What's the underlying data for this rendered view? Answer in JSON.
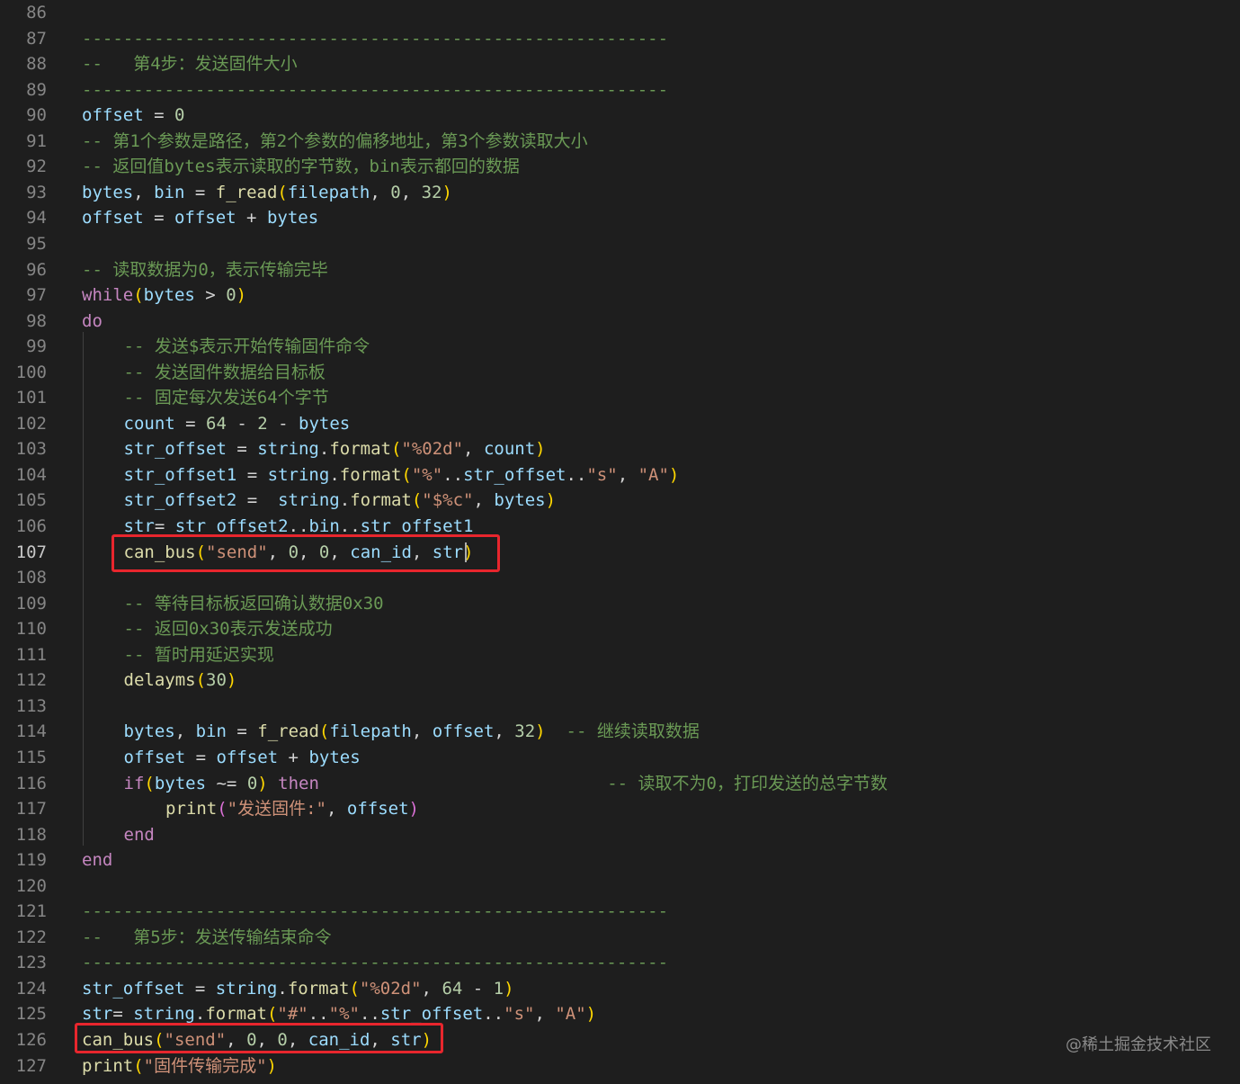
{
  "editor": {
    "lines": [
      {
        "n": "86",
        "indent": 0,
        "tokens": []
      },
      {
        "n": "87",
        "indent": 0,
        "tokens": [
          {
            "t": "c",
            "v": "---------------------------------------------------------"
          }
        ]
      },
      {
        "n": "88",
        "indent": 0,
        "tokens": [
          {
            "t": "c",
            "v": "--   第4步：发送固件大小"
          }
        ]
      },
      {
        "n": "89",
        "indent": 0,
        "tokens": [
          {
            "t": "c",
            "v": "---------------------------------------------------------"
          }
        ]
      },
      {
        "n": "90",
        "indent": 0,
        "tokens": [
          {
            "t": "v",
            "v": "offset"
          },
          {
            "t": "o",
            "v": " = "
          },
          {
            "t": "n",
            "v": "0"
          }
        ]
      },
      {
        "n": "91",
        "indent": 0,
        "tokens": [
          {
            "t": "c",
            "v": "-- 第1个参数是路径，第2个参数的偏移地址，第3个参数读取大小"
          }
        ]
      },
      {
        "n": "92",
        "indent": 0,
        "tokens": [
          {
            "t": "c",
            "v": "-- 返回值bytes表示读取的字节数，bin表示都回的数据"
          }
        ]
      },
      {
        "n": "93",
        "indent": 0,
        "tokens": [
          {
            "t": "v",
            "v": "bytes"
          },
          {
            "t": "o",
            "v": ", "
          },
          {
            "t": "v",
            "v": "bin"
          },
          {
            "t": "o",
            "v": " = "
          },
          {
            "t": "f",
            "v": "f_read"
          },
          {
            "t": "p1",
            "v": "("
          },
          {
            "t": "v",
            "v": "filepath"
          },
          {
            "t": "o",
            "v": ", "
          },
          {
            "t": "n",
            "v": "0"
          },
          {
            "t": "o",
            "v": ", "
          },
          {
            "t": "n",
            "v": "32"
          },
          {
            "t": "p1",
            "v": ")"
          }
        ]
      },
      {
        "n": "94",
        "indent": 0,
        "tokens": [
          {
            "t": "v",
            "v": "offset"
          },
          {
            "t": "o",
            "v": " = "
          },
          {
            "t": "v",
            "v": "offset"
          },
          {
            "t": "o",
            "v": " + "
          },
          {
            "t": "v",
            "v": "bytes"
          }
        ]
      },
      {
        "n": "95",
        "indent": 0,
        "tokens": []
      },
      {
        "n": "96",
        "indent": 0,
        "tokens": [
          {
            "t": "c",
            "v": "-- 读取数据为0，表示传输完毕"
          }
        ]
      },
      {
        "n": "97",
        "indent": 0,
        "tokens": [
          {
            "t": "k",
            "v": "while"
          },
          {
            "t": "p1",
            "v": "("
          },
          {
            "t": "v",
            "v": "bytes"
          },
          {
            "t": "o",
            "v": " > "
          },
          {
            "t": "n",
            "v": "0"
          },
          {
            "t": "p1",
            "v": ")"
          }
        ]
      },
      {
        "n": "98",
        "indent": 0,
        "tokens": [
          {
            "t": "k",
            "v": "do"
          }
        ]
      },
      {
        "n": "99",
        "indent": 1,
        "tokens": [
          {
            "t": "c",
            "v": "-- 发送$表示开始传输固件命令"
          }
        ]
      },
      {
        "n": "100",
        "indent": 1,
        "tokens": [
          {
            "t": "c",
            "v": "-- 发送固件数据给目标板"
          }
        ]
      },
      {
        "n": "101",
        "indent": 1,
        "tokens": [
          {
            "t": "c",
            "v": "-- 固定每次发送64个字节"
          }
        ]
      },
      {
        "n": "102",
        "indent": 1,
        "tokens": [
          {
            "t": "v",
            "v": "count"
          },
          {
            "t": "o",
            "v": " = "
          },
          {
            "t": "n",
            "v": "64"
          },
          {
            "t": "o",
            "v": " - "
          },
          {
            "t": "n",
            "v": "2"
          },
          {
            "t": "o",
            "v": " - "
          },
          {
            "t": "v",
            "v": "bytes"
          }
        ]
      },
      {
        "n": "103",
        "indent": 1,
        "tokens": [
          {
            "t": "v",
            "v": "str_offset"
          },
          {
            "t": "o",
            "v": " = "
          },
          {
            "t": "v",
            "v": "string"
          },
          {
            "t": "o",
            "v": "."
          },
          {
            "t": "f",
            "v": "format"
          },
          {
            "t": "p1",
            "v": "("
          },
          {
            "t": "s",
            "v": "\"%02d\""
          },
          {
            "t": "o",
            "v": ", "
          },
          {
            "t": "v",
            "v": "count"
          },
          {
            "t": "p1",
            "v": ")"
          }
        ]
      },
      {
        "n": "104",
        "indent": 1,
        "tokens": [
          {
            "t": "v",
            "v": "str_offset1"
          },
          {
            "t": "o",
            "v": " = "
          },
          {
            "t": "v",
            "v": "string"
          },
          {
            "t": "o",
            "v": "."
          },
          {
            "t": "f",
            "v": "format"
          },
          {
            "t": "p1",
            "v": "("
          },
          {
            "t": "s",
            "v": "\"%\""
          },
          {
            "t": "o",
            "v": ".."
          },
          {
            "t": "v",
            "v": "str_offset"
          },
          {
            "t": "o",
            "v": ".."
          },
          {
            "t": "s",
            "v": "\"s\""
          },
          {
            "t": "o",
            "v": ", "
          },
          {
            "t": "s",
            "v": "\"A\""
          },
          {
            "t": "p1",
            "v": ")"
          }
        ]
      },
      {
        "n": "105",
        "indent": 1,
        "tokens": [
          {
            "t": "v",
            "v": "str_offset2"
          },
          {
            "t": "o",
            "v": " =  "
          },
          {
            "t": "v",
            "v": "string"
          },
          {
            "t": "o",
            "v": "."
          },
          {
            "t": "f",
            "v": "format"
          },
          {
            "t": "p1",
            "v": "("
          },
          {
            "t": "s",
            "v": "\"$%c\""
          },
          {
            "t": "o",
            "v": ", "
          },
          {
            "t": "v",
            "v": "bytes"
          },
          {
            "t": "p1",
            "v": ")"
          }
        ]
      },
      {
        "n": "106",
        "indent": 1,
        "tokens": [
          {
            "t": "v",
            "v": "str"
          },
          {
            "t": "o",
            "v": "= "
          },
          {
            "t": "v",
            "v": "str_offset2"
          },
          {
            "t": "o",
            "v": ".."
          },
          {
            "t": "v",
            "v": "bin"
          },
          {
            "t": "o",
            "v": ".."
          },
          {
            "t": "v",
            "v": "str_offset1"
          }
        ]
      },
      {
        "n": "107",
        "indent": 1,
        "active": true,
        "tokens": [
          {
            "t": "f",
            "v": "can_bus"
          },
          {
            "t": "p1",
            "v": "("
          },
          {
            "t": "s",
            "v": "\"send\""
          },
          {
            "t": "o",
            "v": ", "
          },
          {
            "t": "n",
            "v": "0"
          },
          {
            "t": "o",
            "v": ", "
          },
          {
            "t": "n",
            "v": "0"
          },
          {
            "t": "o",
            "v": ", "
          },
          {
            "t": "v",
            "v": "can_id"
          },
          {
            "t": "o",
            "v": ", "
          },
          {
            "t": "v",
            "v": "str"
          },
          {
            "t": "p1",
            "v": ")"
          }
        ]
      },
      {
        "n": "108",
        "indent": 0,
        "tokens": []
      },
      {
        "n": "109",
        "indent": 1,
        "tokens": [
          {
            "t": "c",
            "v": "-- 等待目标板返回确认数据0x30"
          }
        ]
      },
      {
        "n": "110",
        "indent": 1,
        "tokens": [
          {
            "t": "c",
            "v": "-- 返回0x30表示发送成功"
          }
        ]
      },
      {
        "n": "111",
        "indent": 1,
        "tokens": [
          {
            "t": "c",
            "v": "-- 暂时用延迟实现"
          }
        ]
      },
      {
        "n": "112",
        "indent": 1,
        "tokens": [
          {
            "t": "f",
            "v": "delayms"
          },
          {
            "t": "p1",
            "v": "("
          },
          {
            "t": "n",
            "v": "30"
          },
          {
            "t": "p1",
            "v": ")"
          }
        ]
      },
      {
        "n": "113",
        "indent": 0,
        "tokens": []
      },
      {
        "n": "114",
        "indent": 1,
        "tokens": [
          {
            "t": "v",
            "v": "bytes"
          },
          {
            "t": "o",
            "v": ", "
          },
          {
            "t": "v",
            "v": "bin"
          },
          {
            "t": "o",
            "v": " = "
          },
          {
            "t": "f",
            "v": "f_read"
          },
          {
            "t": "p1",
            "v": "("
          },
          {
            "t": "v",
            "v": "filepath"
          },
          {
            "t": "o",
            "v": ", "
          },
          {
            "t": "v",
            "v": "offset"
          },
          {
            "t": "o",
            "v": ", "
          },
          {
            "t": "n",
            "v": "32"
          },
          {
            "t": "p1",
            "v": ")"
          },
          {
            "t": "o",
            "v": "  "
          },
          {
            "t": "c",
            "v": "-- 继续读取数据"
          }
        ]
      },
      {
        "n": "115",
        "indent": 1,
        "tokens": [
          {
            "t": "v",
            "v": "offset"
          },
          {
            "t": "o",
            "v": " = "
          },
          {
            "t": "v",
            "v": "offset"
          },
          {
            "t": "o",
            "v": " + "
          },
          {
            "t": "v",
            "v": "bytes"
          }
        ]
      },
      {
        "n": "116",
        "indent": 1,
        "tokens": [
          {
            "t": "k",
            "v": "if"
          },
          {
            "t": "p1",
            "v": "("
          },
          {
            "t": "v",
            "v": "bytes"
          },
          {
            "t": "o",
            "v": " ~= "
          },
          {
            "t": "n",
            "v": "0"
          },
          {
            "t": "p1",
            "v": ")"
          },
          {
            "t": "o",
            "v": " "
          },
          {
            "t": "k",
            "v": "then"
          },
          {
            "t": "o",
            "v": "                            "
          },
          {
            "t": "c",
            "v": "-- 读取不为0，打印发送的总字节数"
          }
        ]
      },
      {
        "n": "117",
        "indent": 2,
        "tokens": [
          {
            "t": "f",
            "v": "print"
          },
          {
            "t": "p2",
            "v": "("
          },
          {
            "t": "s",
            "v": "\"发送固件:\""
          },
          {
            "t": "o",
            "v": ", "
          },
          {
            "t": "v",
            "v": "offset"
          },
          {
            "t": "p2",
            "v": ")"
          }
        ]
      },
      {
        "n": "118",
        "indent": 1,
        "tokens": [
          {
            "t": "k",
            "v": "end"
          }
        ]
      },
      {
        "n": "119",
        "indent": 0,
        "tokens": [
          {
            "t": "k",
            "v": "end"
          }
        ]
      },
      {
        "n": "120",
        "indent": 0,
        "tokens": []
      },
      {
        "n": "121",
        "indent": 0,
        "tokens": [
          {
            "t": "c",
            "v": "---------------------------------------------------------"
          }
        ]
      },
      {
        "n": "122",
        "indent": 0,
        "tokens": [
          {
            "t": "c",
            "v": "--   第5步：发送传输结束命令"
          }
        ]
      },
      {
        "n": "123",
        "indent": 0,
        "tokens": [
          {
            "t": "c",
            "v": "---------------------------------------------------------"
          }
        ]
      },
      {
        "n": "124",
        "indent": 0,
        "tokens": [
          {
            "t": "v",
            "v": "str_offset"
          },
          {
            "t": "o",
            "v": " = "
          },
          {
            "t": "v",
            "v": "string"
          },
          {
            "t": "o",
            "v": "."
          },
          {
            "t": "f",
            "v": "format"
          },
          {
            "t": "p1",
            "v": "("
          },
          {
            "t": "s",
            "v": "\"%02d\""
          },
          {
            "t": "o",
            "v": ", "
          },
          {
            "t": "n",
            "v": "64"
          },
          {
            "t": "o",
            "v": " - "
          },
          {
            "t": "n",
            "v": "1"
          },
          {
            "t": "p1",
            "v": ")"
          }
        ]
      },
      {
        "n": "125",
        "indent": 0,
        "tokens": [
          {
            "t": "v",
            "v": "str"
          },
          {
            "t": "o",
            "v": "= "
          },
          {
            "t": "v",
            "v": "string"
          },
          {
            "t": "o",
            "v": "."
          },
          {
            "t": "f",
            "v": "format"
          },
          {
            "t": "p1",
            "v": "("
          },
          {
            "t": "s",
            "v": "\"#\""
          },
          {
            "t": "o",
            "v": ".."
          },
          {
            "t": "s",
            "v": "\"%\""
          },
          {
            "t": "o",
            "v": ".."
          },
          {
            "t": "v",
            "v": "str_offset"
          },
          {
            "t": "o",
            "v": ".."
          },
          {
            "t": "s",
            "v": "\"s\""
          },
          {
            "t": "o",
            "v": ", "
          },
          {
            "t": "s",
            "v": "\"A\""
          },
          {
            "t": "p1",
            "v": ")"
          }
        ]
      },
      {
        "n": "126",
        "indent": 0,
        "tokens": [
          {
            "t": "f",
            "v": "can_bus"
          },
          {
            "t": "p1",
            "v": "("
          },
          {
            "t": "s",
            "v": "\"send\""
          },
          {
            "t": "o",
            "v": ", "
          },
          {
            "t": "n",
            "v": "0"
          },
          {
            "t": "o",
            "v": ", "
          },
          {
            "t": "n",
            "v": "0"
          },
          {
            "t": "o",
            "v": ", "
          },
          {
            "t": "v",
            "v": "can_id"
          },
          {
            "t": "o",
            "v": ", "
          },
          {
            "t": "v",
            "v": "str"
          },
          {
            "t": "p1",
            "v": ")"
          }
        ]
      },
      {
        "n": "127",
        "indent": 0,
        "tokens": [
          {
            "t": "f",
            "v": "print"
          },
          {
            "t": "p1",
            "v": "("
          },
          {
            "t": "s",
            "v": "\"固件传输完成\""
          },
          {
            "t": "p1",
            "v": ")"
          }
        ]
      }
    ]
  },
  "watermark": "@稀土掘金技术社区",
  "colors": {
    "background": "#1e1e1e",
    "highlight_box": "#e8262d",
    "comment": "#6a9955",
    "variable": "#9cdcfe",
    "keyword": "#c586c0",
    "function": "#dcdcaa",
    "string": "#ce9178",
    "number": "#b5cea8"
  }
}
